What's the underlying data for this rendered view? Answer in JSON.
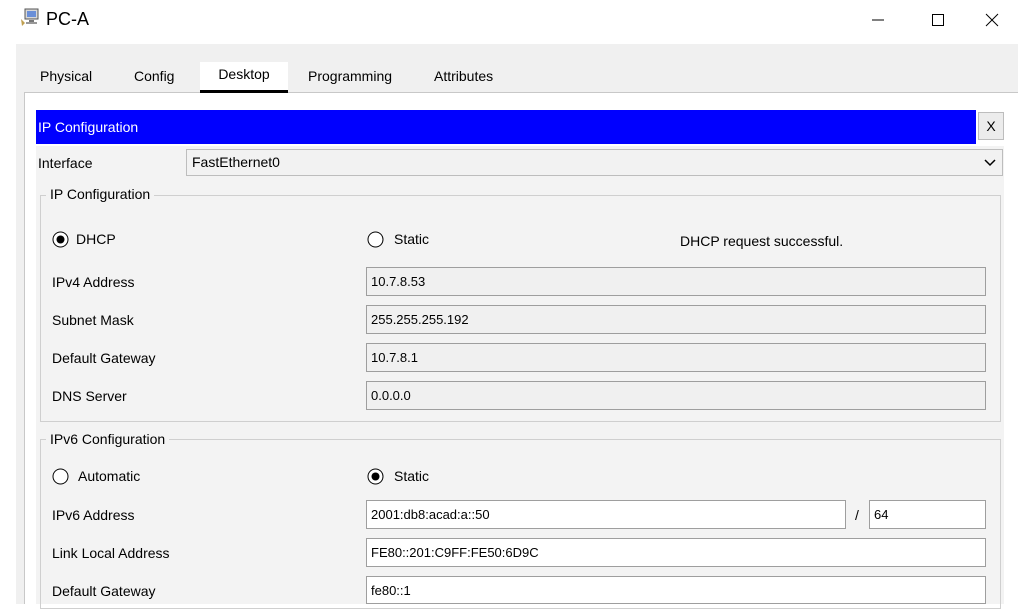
{
  "window": {
    "title": "PC-A",
    "icon": "pc-icon",
    "controls": {
      "minimize": "—",
      "maximize": "☐",
      "close": "✕"
    }
  },
  "tabs": [
    "Physical",
    "Config",
    "Desktop",
    "Programming",
    "Attributes"
  ],
  "active_tab": "Desktop",
  "ip_config": {
    "title": "IP Configuration",
    "close_label": "X",
    "interface_label": "Interface",
    "interface_value": "FastEthernet0",
    "ipv4": {
      "legend": "IP Configuration",
      "dhcp_label": "DHCP",
      "static_label": "Static",
      "mode": "DHCP",
      "status": "DHCP request successful.",
      "fields": {
        "address_label": "IPv4 Address",
        "address": "10.7.8.53",
        "mask_label": "Subnet Mask",
        "mask": "255.255.255.192",
        "gateway_label": "Default Gateway",
        "gateway": "10.7.8.1",
        "dns_label": "DNS Server",
        "dns": "0.0.0.0"
      }
    },
    "ipv6": {
      "legend": "IPv6 Configuration",
      "auto_label": "Automatic",
      "static_label": "Static",
      "mode": "Static",
      "fields": {
        "address_label": "IPv6 Address",
        "address": "2001:db8:acad:a::50",
        "slash": "/",
        "prefix": "64",
        "link_local_label": "Link Local Address",
        "link_local": "FE80::201:C9FF:FE50:6D9C",
        "gateway_label": "Default Gateway",
        "gateway": "fe80::1"
      }
    }
  },
  "colors": {
    "title_bar": "#0000ff",
    "panel": "#f0f0f0"
  }
}
